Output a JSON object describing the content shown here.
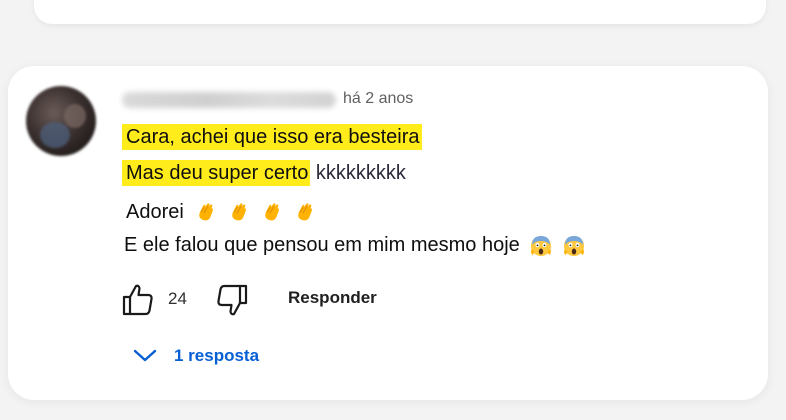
{
  "comment": {
    "timestamp": "há 2 anos",
    "lines": {
      "line1": "Cara, achei que isso era besteira",
      "line2_highlighted": "Mas deu super certo",
      "line2_rest": " kkkkkkkkk",
      "line3": "Adorei",
      "line4": "E ele falou que pensou em mim mesmo hoje"
    },
    "emojis": {
      "line3": [
        "clapping-hands",
        "clapping-hands",
        "clapping-hands",
        "clapping-hands"
      ],
      "line4": [
        "face-screaming-in-fear",
        "face-screaming-in-fear"
      ]
    },
    "highlight_color": "#ffec1a"
  },
  "actions": {
    "like_count": "24",
    "reply_label": "Responder"
  },
  "replies": {
    "toggle_label": "1 resposta",
    "link_color": "#065fd4"
  }
}
